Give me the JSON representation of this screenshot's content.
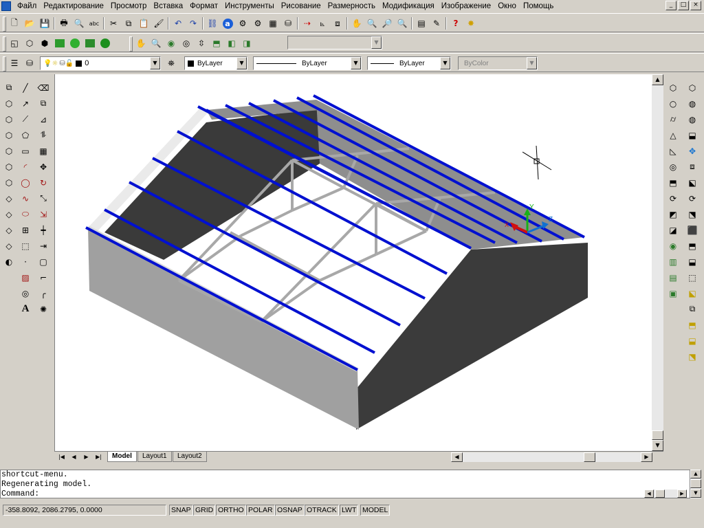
{
  "menu": {
    "items": [
      "Файл",
      "Редактирование",
      "Просмотр",
      "Вставка",
      "Формат",
      "Инструменты",
      "Рисование",
      "Размерность",
      "Модификация",
      "Изображение",
      "Окно",
      "Помощь"
    ]
  },
  "window_controls": [
    "_",
    "□",
    "×"
  ],
  "properties": {
    "layer": "0",
    "color": "ByLayer",
    "linetype": "ByLayer",
    "lineweight": "ByLayer",
    "plotstyle": "ByColor"
  },
  "icons": {
    "standard": [
      "new-icon",
      "open-icon",
      "save-icon",
      "print-icon",
      "print-preview-icon",
      "spellcheck-icon",
      "cut-icon",
      "copy-icon",
      "paste-icon",
      "match-properties-icon",
      "undo-icon",
      "redo-icon",
      "hyperlink-icon",
      "autodesk-today-icon",
      "design-center-icon",
      "properties-icon",
      "tool-palettes-icon",
      "dbconnect-icon",
      "measure-icon",
      "ucs-icon",
      "named-views-icon",
      "pan-icon",
      "zoom-realtime-icon",
      "zoom-window-icon",
      "zoom-previous-icon",
      "help-icon",
      "sun-icon"
    ],
    "draw": [
      "line-icon",
      "ray-icon",
      "polyline-icon",
      "polygon-icon",
      "rectangle-icon",
      "arc-icon",
      "circle-icon",
      "spline-icon",
      "ellipse-icon",
      "insert-block-icon",
      "make-block-icon",
      "point-icon",
      "hatch-icon",
      "region-icon",
      "text-icon"
    ],
    "modify": [
      "erase-icon",
      "copy-object-icon",
      "mirror-icon",
      "offset-icon",
      "array-icon",
      "move-icon",
      "rotate-icon",
      "scale-icon",
      "stretch-icon",
      "trim-icon",
      "extend-icon",
      "break-icon",
      "chamfer-icon",
      "fillet-icon",
      "explode-icon"
    ]
  },
  "tabs": [
    "Model",
    "Layout1",
    "Layout2"
  ],
  "active_tab": "Model",
  "command_lines": [
    "shortcut-menu.",
    "Regenerating model.",
    "Command:"
  ],
  "status": {
    "coords": "-358.8092, 2086.2795, 0.0000",
    "buttons": [
      "SNAP",
      "GRID",
      "ORTHO",
      "POLAR",
      "OSNAP",
      "OTRACK",
      "LWT",
      "MODEL"
    ]
  },
  "ucs": {
    "x": "X",
    "y": "Y",
    "z": "Z"
  },
  "colors": {
    "rafters": "#0010d0",
    "truss": "#a8a8a8",
    "gable_dark": "#3a3a3a",
    "wall_side": "#9a9a9a",
    "roof_gray": "#8c8c8c"
  }
}
